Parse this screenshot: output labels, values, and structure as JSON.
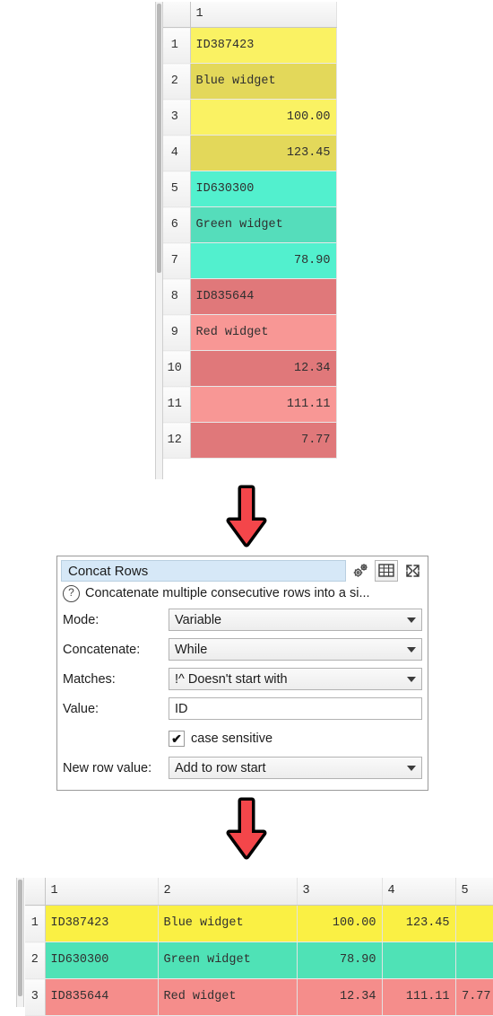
{
  "input_table": {
    "name": "input-grid",
    "columns": [
      "1"
    ],
    "row_numbers": [
      "1",
      "2",
      "3",
      "4",
      "5",
      "6",
      "7",
      "8",
      "9",
      "10",
      "11",
      "12"
    ],
    "rows": [
      {
        "value": "ID387423",
        "align": "txt",
        "color": "#FAF263"
      },
      {
        "value": "Blue widget",
        "align": "txt",
        "color": "#E3D85A"
      },
      {
        "value": "100.00",
        "align": "num",
        "color": "#FAF263"
      },
      {
        "value": "123.45",
        "align": "num",
        "color": "#E3D85A"
      },
      {
        "value": "ID630300",
        "align": "txt",
        "color": "#52F0CE"
      },
      {
        "value": "Green widget",
        "align": "txt",
        "color": "#55DDBB"
      },
      {
        "value": "78.90",
        "align": "num",
        "color": "#52F0CE"
      },
      {
        "value": "ID835644",
        "align": "txt",
        "color": "#E0787A"
      },
      {
        "value": "Red widget",
        "align": "txt",
        "color": "#F89795"
      },
      {
        "value": "12.34",
        "align": "num",
        "color": "#E0787A"
      },
      {
        "value": "111.11",
        "align": "num",
        "color": "#F89795"
      },
      {
        "value": "7.77",
        "align": "num",
        "color": "#E0787A"
      }
    ]
  },
  "dialog": {
    "title": "Concat Rows",
    "toolbar": {
      "settings_icon": "gears-icon",
      "table_icon": "table-icon",
      "expand_icon": "expand-icon"
    },
    "help_icon": "question-icon",
    "help_text": "Concatenate multiple consecutive rows into a si...",
    "fields": [
      {
        "label": "Mode:",
        "kind": "combo",
        "value": "Variable"
      },
      {
        "label": "Concatenate:",
        "kind": "combo",
        "value": "While"
      },
      {
        "label": "Matches:",
        "kind": "combo",
        "value": "!^  Doesn't start with"
      },
      {
        "label": "Value:",
        "kind": "text",
        "value": "ID"
      }
    ],
    "checkbox": {
      "label": "case sensitive",
      "checked": true,
      "mark": "✔"
    },
    "new_row_value": {
      "label": "New row value:",
      "value": "Add to row start"
    }
  },
  "arrows": {
    "top": "down-arrow-icon",
    "bottom": "down-arrow-icon",
    "fill": "#F4464A",
    "outline": "#000000"
  },
  "output_table": {
    "name": "output-grid",
    "columns": [
      "1",
      "2",
      "3",
      "4",
      "5"
    ],
    "row_numbers": [
      "1",
      "2",
      "3"
    ],
    "rows": [
      {
        "color": "#FAF044",
        "cells": [
          {
            "value": "ID387423",
            "align": "txt"
          },
          {
            "value": "Blue widget",
            "align": "txt"
          },
          {
            "value": "100.00",
            "align": "num"
          },
          {
            "value": "123.45",
            "align": "num"
          },
          {
            "value": "",
            "align": "num"
          }
        ]
      },
      {
        "color": "#4FE2B6",
        "cells": [
          {
            "value": "ID630300",
            "align": "txt"
          },
          {
            "value": "Green widget",
            "align": "txt"
          },
          {
            "value": "78.90",
            "align": "num"
          },
          {
            "value": "",
            "align": "num"
          },
          {
            "value": "",
            "align": "num"
          }
        ]
      },
      {
        "color": "#F58D8B",
        "cells": [
          {
            "value": "ID835644",
            "align": "txt"
          },
          {
            "value": "Red widget",
            "align": "txt"
          },
          {
            "value": "12.34",
            "align": "num"
          },
          {
            "value": "111.11",
            "align": "num"
          },
          {
            "value": "7.77",
            "align": "num"
          }
        ]
      }
    ]
  }
}
